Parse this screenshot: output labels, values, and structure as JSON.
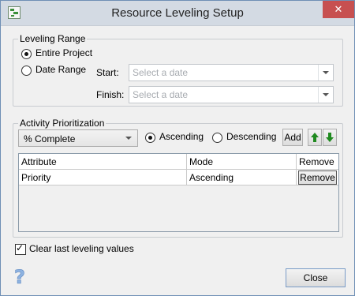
{
  "window": {
    "title": "Resource Leveling Setup"
  },
  "leveling_range": {
    "group_label": "Leveling Range",
    "options": [
      {
        "label": "Entire Project",
        "checked": true
      },
      {
        "label": "Date Range",
        "checked": false
      }
    ],
    "start_label": "Start:",
    "start_placeholder": "Select a date",
    "finish_label": "Finish:",
    "finish_placeholder": "Select a date"
  },
  "activity_prioritization": {
    "group_label": "Activity Prioritization",
    "attribute_combo_value": "% Complete",
    "order_options": [
      {
        "label": "Ascending",
        "checked": true
      },
      {
        "label": "Descending",
        "checked": false
      }
    ],
    "add_label": "Add",
    "move_up_icon": "arrow-up-icon",
    "move_down_icon": "arrow-down-icon",
    "grid": {
      "columns": [
        "Attribute",
        "Mode",
        "Remove"
      ],
      "rows": [
        {
          "attribute": "Priority",
          "mode": "Ascending",
          "remove_label": "Remove"
        }
      ]
    }
  },
  "clear_last_values": {
    "label": "Clear last leveling values",
    "checked": true
  },
  "help_icon": "help-icon",
  "close_label": "Close",
  "colors": {
    "close_button": "#c75050",
    "arrow_green": "#1f8a1f",
    "titlebar": "#d3dae3"
  }
}
